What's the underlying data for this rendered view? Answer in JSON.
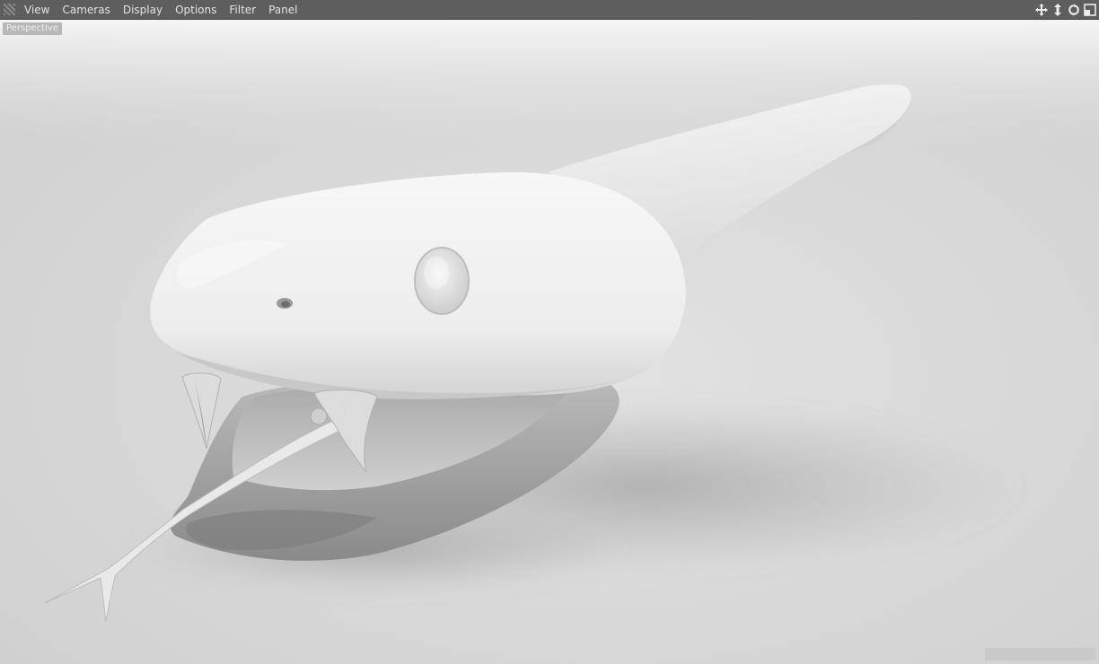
{
  "menubar": {
    "items": [
      "View",
      "Cameras",
      "Display",
      "Options",
      "Filter",
      "Panel"
    ]
  },
  "viewport": {
    "camera_label": "Perspective",
    "status_label": ""
  },
  "colors": {
    "menubar_bg": "#5e5e5e",
    "menu_text": "#e3e3e3",
    "viewport_bg": "#d6d6d6",
    "model_shade": "#f0f0f0"
  }
}
